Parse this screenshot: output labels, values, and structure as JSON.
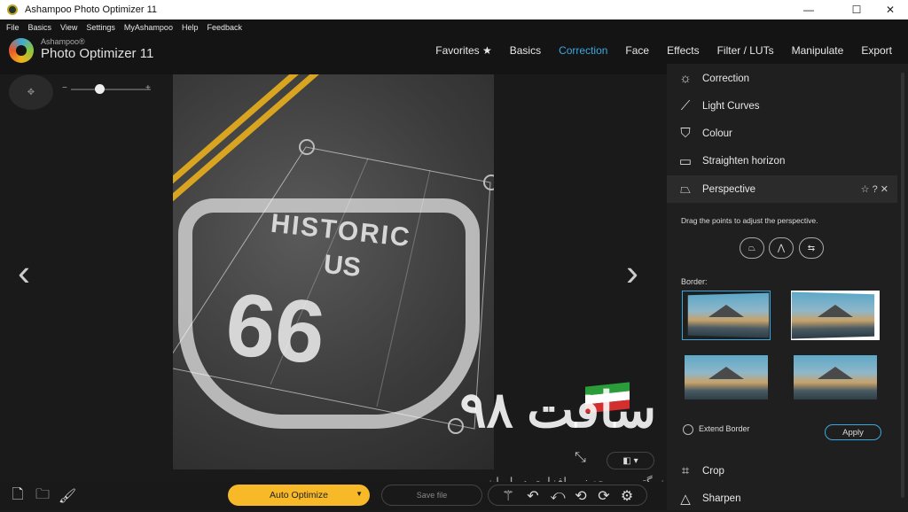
{
  "window": {
    "title": "Ashampoo Photo Optimizer 11",
    "controls": {
      "minimize": "—",
      "maximize": "☐",
      "close": "✕"
    }
  },
  "menu": [
    "File",
    "Basics",
    "View",
    "Settings",
    "MyAshampoo",
    "Help",
    "Feedback"
  ],
  "logo": {
    "brand": "Ashampoo®",
    "product": "Photo Optimizer 11"
  },
  "nav": {
    "tabs": [
      "Favorites ★",
      "Basics",
      "Correction",
      "Face",
      "Effects",
      "Filter / LUTs",
      "Manipulate",
      "Export"
    ],
    "active": "Correction"
  },
  "image": {
    "prev_arrow": "‹",
    "next_arrow": "›",
    "sign_line1": "HISTORIC",
    "sign_line2": "US",
    "sign_number": "66"
  },
  "zoom": {
    "minus": "−",
    "plus": "+",
    "value": 0.35
  },
  "panel": {
    "items": [
      {
        "label": "Correction",
        "icon": "sun-icon"
      },
      {
        "label": "Light Curves",
        "icon": "curve-icon"
      },
      {
        "label": "Colour",
        "icon": "bucket-icon"
      },
      {
        "label": "Straighten horizon",
        "icon": "landscape-icon"
      },
      {
        "label": "Perspective",
        "icon": "perspective-icon",
        "selected": true
      }
    ],
    "perspective_tools": {
      "favorite": "☆",
      "help": "?",
      "close": "✕"
    },
    "drag_hint": "Drag the points to adjust the perspective.",
    "border_label": "Border:",
    "extend_border": "Extend Border",
    "apply": "Apply",
    "lower_items": [
      {
        "label": "Crop",
        "icon": "crop-icon"
      },
      {
        "label": "Sharpen",
        "icon": "triangle-icon"
      }
    ]
  },
  "bottom": {
    "auto_optimize": "Auto Optimize",
    "save_file": "Save file"
  },
  "watermark": {
    "logo_text": "سافت ۹۸",
    "tagline": "بزرگترین مرجع نرم افزاری در ایران"
  },
  "colors": {
    "accent": "#3aa8e0",
    "auto_button": "#f7b928",
    "lane": "#d9a521"
  }
}
